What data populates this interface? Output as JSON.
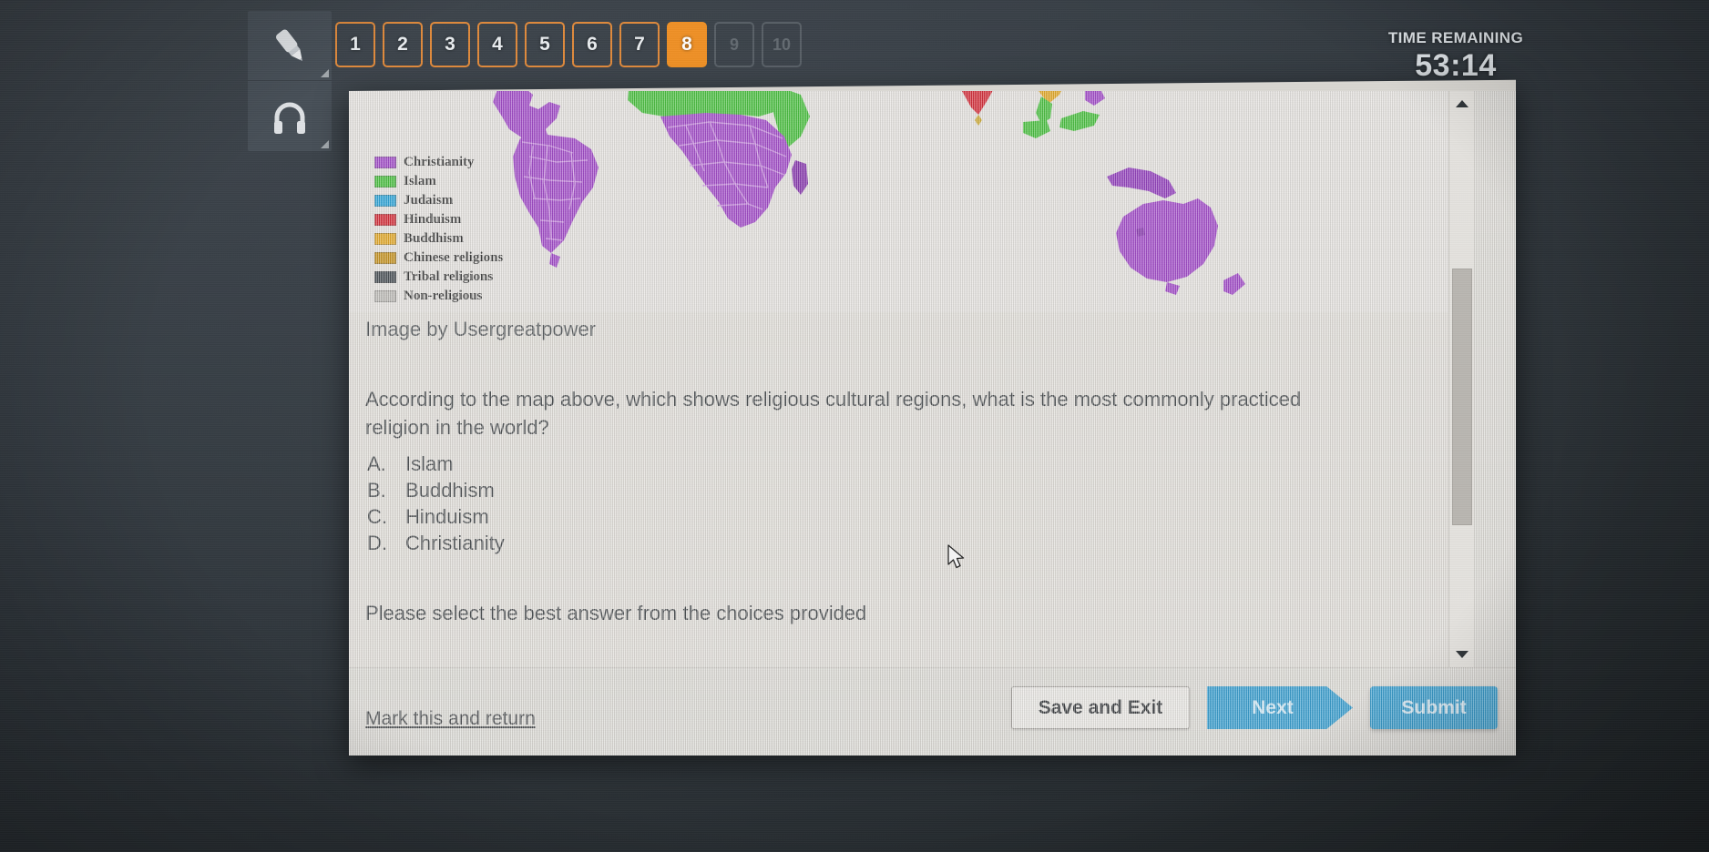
{
  "exam": {
    "tools": [
      {
        "name": "highlighter-tool",
        "icon": "highlighter-icon"
      },
      {
        "name": "audio-tool",
        "icon": "headphones-icon"
      }
    ],
    "question_nav": [
      {
        "label": "1",
        "state": "available"
      },
      {
        "label": "2",
        "state": "available"
      },
      {
        "label": "3",
        "state": "available"
      },
      {
        "label": "4",
        "state": "available"
      },
      {
        "label": "5",
        "state": "available"
      },
      {
        "label": "6",
        "state": "available"
      },
      {
        "label": "7",
        "state": "available"
      },
      {
        "label": "8",
        "state": "current"
      },
      {
        "label": "9",
        "state": "locked"
      },
      {
        "label": "10",
        "state": "locked"
      }
    ],
    "timer": {
      "label": "TIME REMAINING",
      "value": "53:14"
    }
  },
  "map": {
    "legend_title": "",
    "legend": [
      {
        "label": "Christianity",
        "color": "#9b3fc4"
      },
      {
        "label": "Islam",
        "color": "#3dbb32"
      },
      {
        "label": "Judaism",
        "color": "#1f9fd4"
      },
      {
        "label": "Hinduism",
        "color": "#d11f2c"
      },
      {
        "label": "Buddhism",
        "color": "#e0a21a"
      },
      {
        "label": "Chinese religions",
        "color": "#c08a12"
      },
      {
        "label": "Tribal religions",
        "color": "#3c4349"
      },
      {
        "label": "Non-religious",
        "color": "#b7b5b1"
      }
    ]
  },
  "question": {
    "credit": "Image by Usergreatpower",
    "text": "According to the map above, which shows religious cultural regions, what is the most commonly practiced religion in the world?",
    "choices": [
      {
        "letter": "A.",
        "text": "Islam"
      },
      {
        "letter": "B.",
        "text": "Buddhism"
      },
      {
        "letter": "C.",
        "text": "Hinduism"
      },
      {
        "letter": "D.",
        "text": "Christianity"
      }
    ],
    "instruction": "Please select the best answer from the choices provided"
  },
  "footer": {
    "mark_link": "Mark this and return",
    "save_exit": "Save and Exit",
    "next": "Next",
    "submit": "Submit"
  },
  "colors": {
    "accent_orange": "#ef9026",
    "accent_blue": "#2b97cb",
    "panel_bg": "#d9d7d2",
    "app_bg": "#3a4249"
  }
}
